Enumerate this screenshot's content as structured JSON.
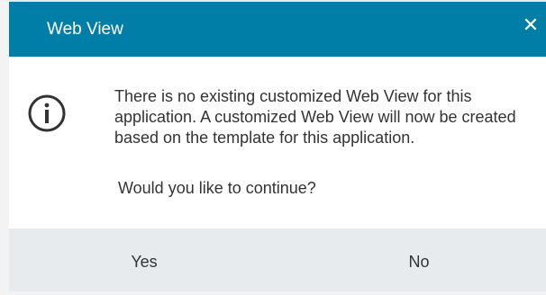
{
  "dialog": {
    "title": "Web View",
    "close_icon": "close-icon",
    "info_icon": "info-icon",
    "message": "There is no existing customized Web View for this application. A customized Web View will now be created based on the template for this application.",
    "question": "Would you like to continue?",
    "buttons": {
      "yes": "Yes",
      "no": "No"
    }
  },
  "colors": {
    "titlebar": "#007ea8",
    "footer": "#e7ebee",
    "text": "#333333",
    "icon": "#333333"
  }
}
